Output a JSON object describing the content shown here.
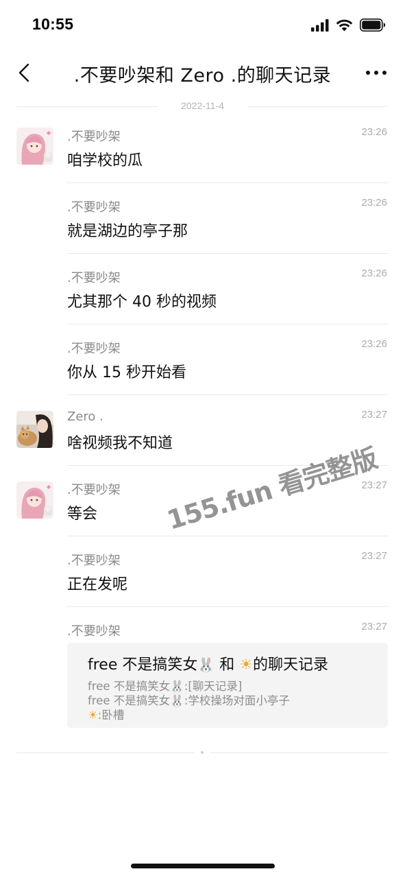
{
  "status_bar": {
    "time": "10:55"
  },
  "nav": {
    "title": ".不要吵架和 Zero .的聊天记录"
  },
  "date_label": "2022-11-4",
  "messages": [
    {
      "sender": ".不要吵架",
      "time": "23:26",
      "text": "咱学校的瓜"
    },
    {
      "sender": ".不要吵架",
      "time": "23:26",
      "text": "就是湖边的亭子那"
    },
    {
      "sender": ".不要吵架",
      "time": "23:26",
      "text": "尤其那个 40 秒的视频"
    },
    {
      "sender": ".不要吵架",
      "time": "23:26",
      "text": "你从 15 秒开始看"
    },
    {
      "sender": "Zero .",
      "time": "23:27",
      "text": "啥视频我不知道"
    },
    {
      "sender": ".不要吵架",
      "time": "23:27",
      "text": "等会"
    },
    {
      "sender": ".不要吵架",
      "time": "23:27",
      "text": "正在发呢"
    },
    {
      "sender": ".不要吵架",
      "time": "23:27"
    }
  ],
  "forward_card": {
    "title_a": "free 不是搞笑女",
    "title_b": "和",
    "title_c": "的聊天记录",
    "line1_name": "free 不是搞笑女",
    "line1_text": ":[聊天记录]",
    "line2_name": "free 不是搞笑女",
    "line2_text": ":学校操场对面小亭子",
    "line3_text": ":卧槽"
  },
  "watermark": {
    "text": "155.fun 看完整版"
  }
}
